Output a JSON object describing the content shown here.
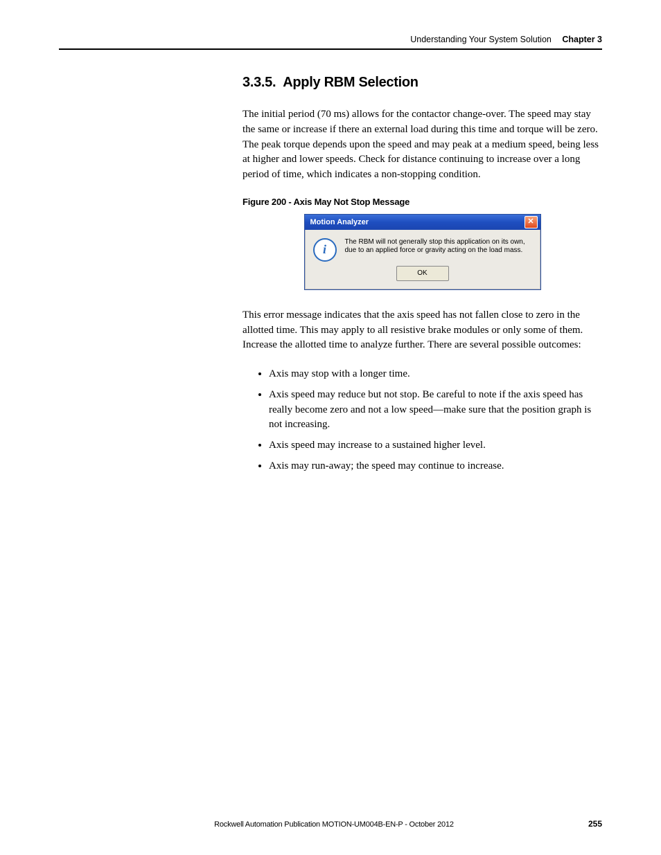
{
  "header": {
    "doc_title": "Understanding Your System Solution",
    "chapter": "Chapter 3"
  },
  "section": {
    "number": "3.3.5.",
    "title": "Apply RBM Selection"
  },
  "para1": "The initial period (70 ms) allows for the contactor change-over. The speed may stay the same or increase if there an external load during this time and torque will be zero. The peak torque depends upon the speed and may peak at a medium speed, being less at higher and lower speeds. Check for distance continuing to increase over a long period of time, which indicates a non-stopping condition.",
  "figure": {
    "caption": "Figure 200 - Axis May Not Stop Message",
    "dialog_title": "Motion Analyzer",
    "msg_line1": "The RBM will not generally stop this application on its own,",
    "msg_line2": "due to an applied force or gravity acting on the load mass.",
    "ok_label": "OK",
    "close_glyph": "✕"
  },
  "para2": "This error message indicates that the axis speed has not fallen close to zero in the allotted time. This may apply to all resistive brake modules or only some of them. Increase the allotted time to analyze further. There are several possible outcomes:",
  "bullets": [
    "Axis may stop with a longer time.",
    "Axis speed may reduce but not stop. Be careful to note if the axis speed has really become zero and not a low speed—make sure that the position graph is not increasing.",
    "Axis speed may increase to a sustained higher level.",
    "Axis may run-away; the speed may continue to increase."
  ],
  "footer": {
    "publication": "Rockwell Automation Publication MOTION-UM004B-EN-P - October 2012",
    "page": "255"
  },
  "info_glyph": "i"
}
